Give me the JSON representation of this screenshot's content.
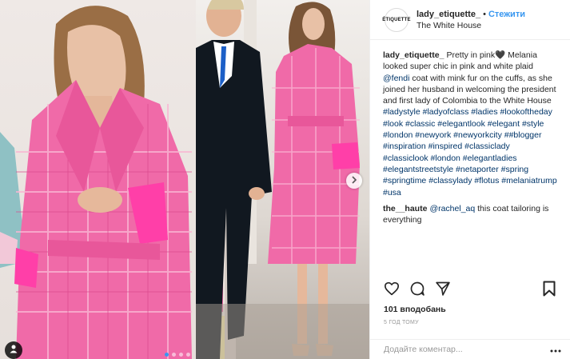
{
  "post": {
    "username": "lady_etiquette_",
    "follow_label": "Стежити",
    "separator": "•",
    "location": "The White House",
    "avatar_text": "ÉTIQUETTE"
  },
  "caption": {
    "username": "lady_etiquette_",
    "text_before_tag": "Pretty in pink🖤 Melania looked super chic in pink and white plaid ",
    "mention": "@fendi",
    "text_after_mention": " coat with mink fur on the cuffs, as she joined her husband in welcoming the president and first lady of Colombia to the White House ",
    "hashtags": "#ladystyle #ladyofclass #ladies #lookoftheday #look #classic #elegantlook #elegant #style #london #newyork #newyorkcity ##blogger #inspiration #inspired #classiclady #classiclook #london #elegantladies #elegantstreetstyle #netaporter #spring #springtime #classylady #flotus #melaniatrump #usa"
  },
  "comment": {
    "username": "the__haute",
    "mention": "@rachel_aq",
    "text": " this coat tailoring is everything"
  },
  "likes_text": "101 вподобань",
  "time_text": "5 ГОД ТОМУ",
  "add_comment_placeholder": "Додайте коментар...",
  "icons": {
    "like": "heart-icon",
    "comment": "comment-icon",
    "share": "share-icon",
    "save": "bookmark-icon",
    "more": "more-icon",
    "next": "chevron-right-icon",
    "user_tag": "user-icon"
  },
  "colors": {
    "link": "#003569",
    "follow": "#3897f0",
    "coat_pink": "#f06aa8"
  }
}
